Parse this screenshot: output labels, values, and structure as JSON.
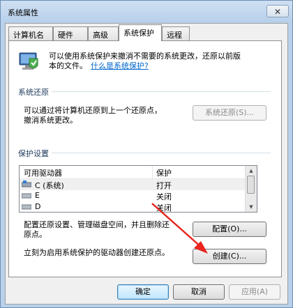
{
  "window": {
    "title": "系统属性",
    "close_glyph": "✕"
  },
  "tabs": [
    {
      "label": "计算机名"
    },
    {
      "label": "硬件"
    },
    {
      "label": "高级"
    },
    {
      "label": "系统保护"
    },
    {
      "label": "远程"
    }
  ],
  "intro": {
    "line1": "可以使用系统保护来撤消不需要的系统更改，还原以前版",
    "line2_prefix": "本的文件。",
    "link": "什么是系统保护?"
  },
  "restore": {
    "group_title": "系统还原",
    "desc_line1": "可以通过将计算机还原到上一个还原点，",
    "desc_line2": "撤消系统更改。",
    "button": "系统还原(S)..."
  },
  "protection": {
    "group_title": "保护设置",
    "columns": [
      "可用驱动器",
      "保护"
    ],
    "drives": [
      {
        "name": "C (系统)",
        "status": "打开"
      },
      {
        "name": "E",
        "status": "关闭"
      },
      {
        "name": "D",
        "status": "关闭"
      }
    ],
    "config_text_line1": "配置还原设置、管理磁盘空间，并且删除还",
    "config_text_line2": "原点。",
    "config_button": "配置(O)...",
    "create_text": "立刻为启用系统保护的驱动器创建还原点。",
    "create_button": "创建(C)..."
  },
  "footer": {
    "ok": "确定",
    "cancel": "取消",
    "apply": "应用(A)"
  },
  "colors": {
    "arrow": "#e8251f",
    "link": "#0066cc"
  }
}
